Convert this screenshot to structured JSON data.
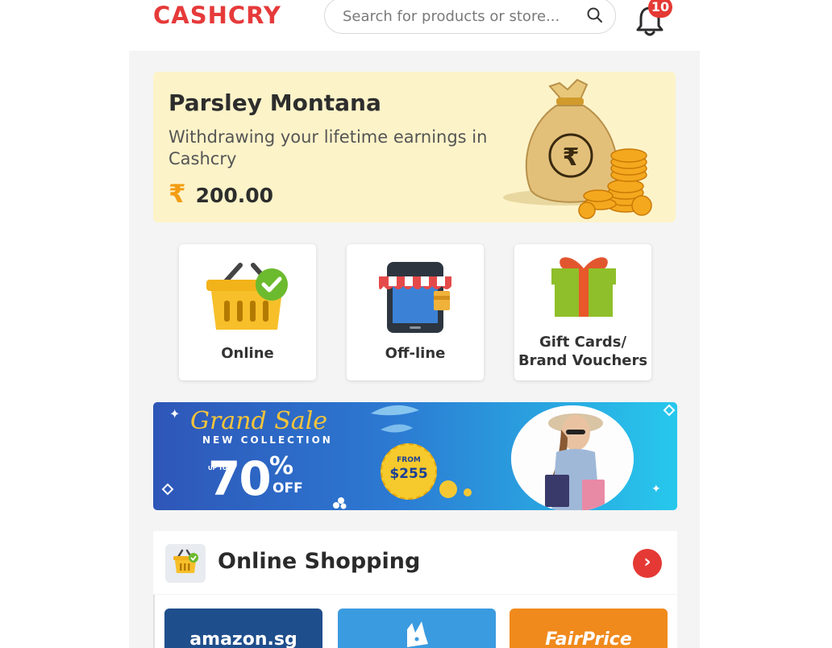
{
  "header": {
    "logo": "CASHCRY",
    "search_placeholder": "Search for products or store...",
    "notification_count": "10"
  },
  "earnings": {
    "name": "Parsley Montana",
    "description": "Withdrawing your lifetime earnings in Cashcry",
    "currency_symbol": "₹",
    "amount": "200.00"
  },
  "categories": [
    {
      "label": "Online",
      "icon": "shopping-basket-icon"
    },
    {
      "label": "Off-line",
      "icon": "store-phone-icon"
    },
    {
      "label": "Gift Cards/\nBrand Vouchers",
      "icon": "gift-box-icon"
    }
  ],
  "banner": {
    "title": "Grand Sale",
    "subtitle": "NEW COLLECTION",
    "upto": "UP TO",
    "discount": "70",
    "percent": "%",
    "off": "OFF",
    "from_label": "FROM",
    "from_price": "$255"
  },
  "online_shopping": {
    "title": "Online Shopping",
    "stores": [
      {
        "name": "amazon.sg",
        "color": "#1f4e8c"
      },
      {
        "name": "deliveroo",
        "color": "#3b9be0"
      },
      {
        "name": "FairPrice",
        "color": "#f08a1c"
      }
    ]
  },
  "colors": {
    "brand_red": "#e63a3a",
    "earnings_bg": "#fdf3c9",
    "rupee_orange": "#f39c12"
  }
}
